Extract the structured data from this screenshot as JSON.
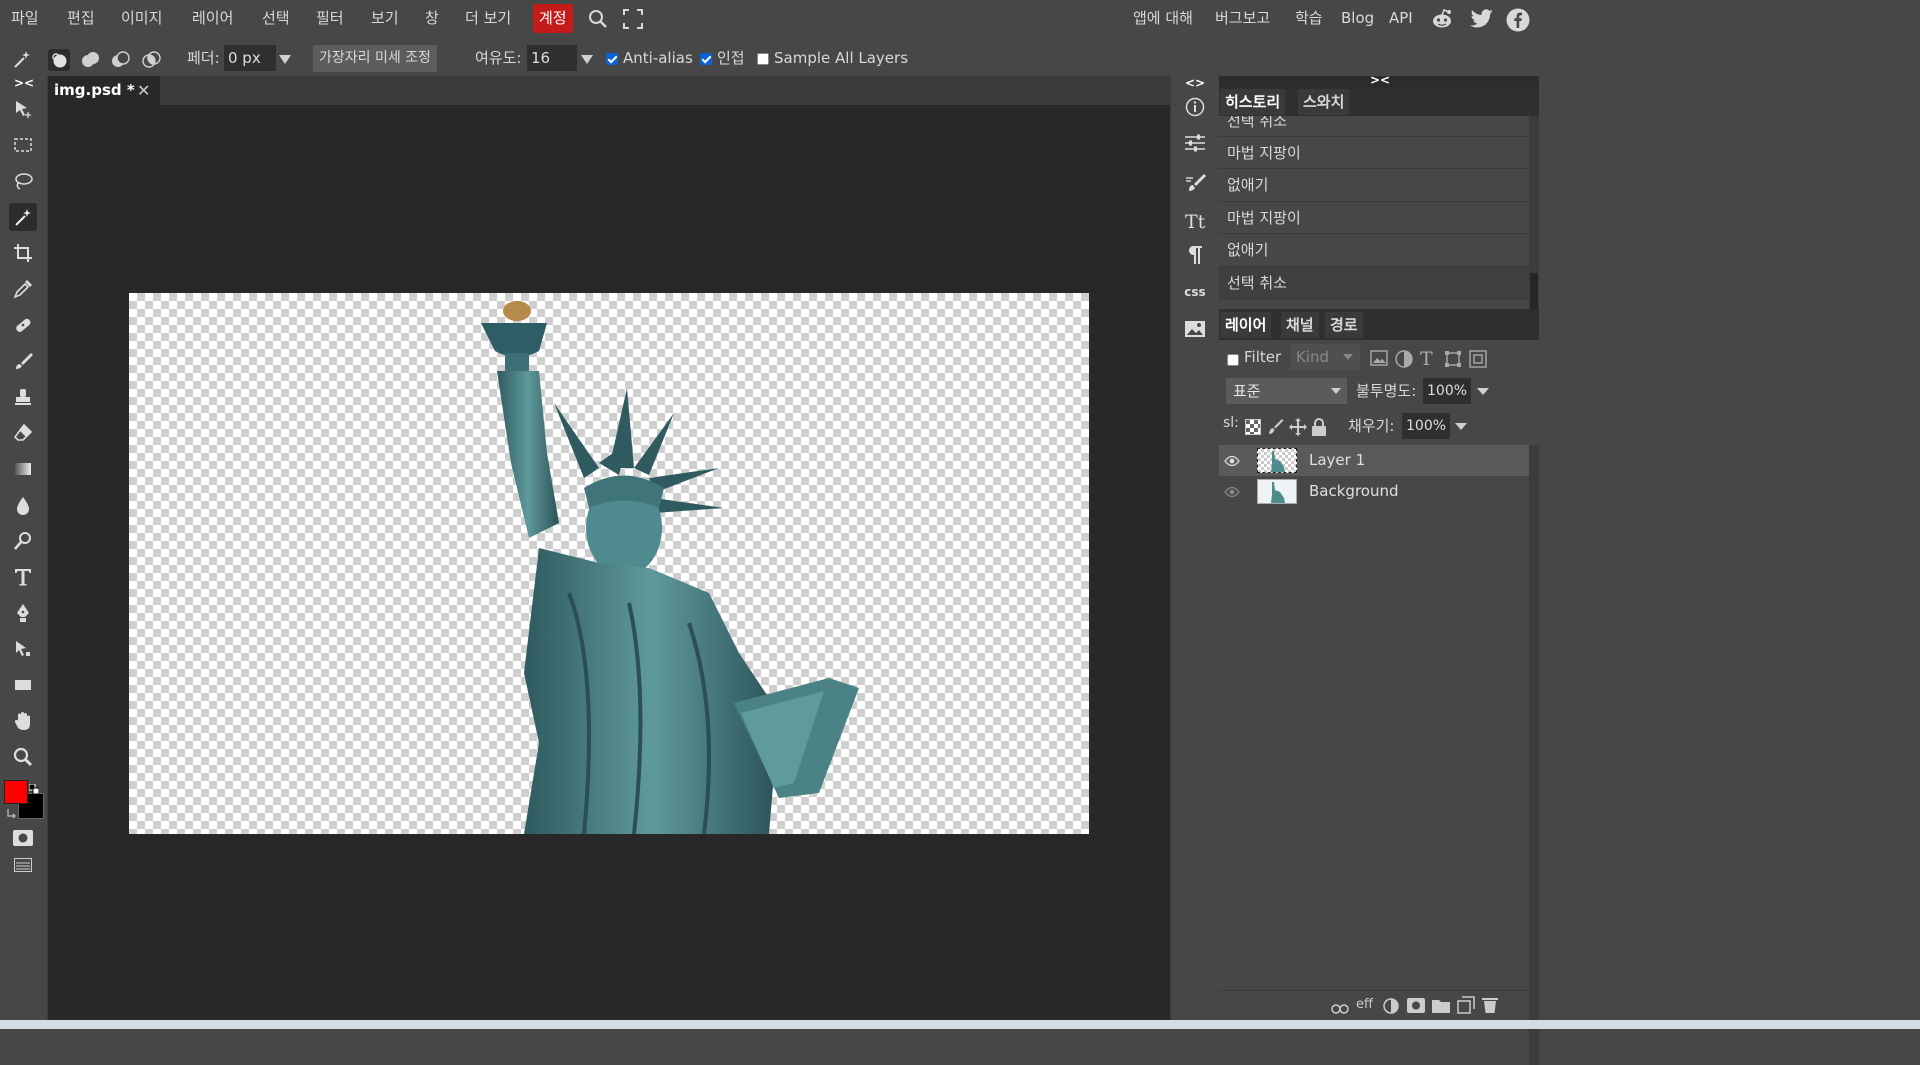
{
  "menubar": {
    "items": [
      "파일",
      "편집",
      "이미지",
      "레이어",
      "선택",
      "필터",
      "보기",
      "창",
      "더 보기"
    ],
    "account": "계정",
    "right_links": [
      "앱에 대해",
      "버그보고",
      "학습",
      "Blog",
      "API"
    ],
    "account_color": "#c41a1a"
  },
  "options": {
    "feather_label": "페더:",
    "feather_value": "0 px",
    "refine_edge": "가장자리 미세 조정",
    "tolerance_label": "여유도:",
    "tolerance_value": "16",
    "antialias_label": "Anti-alias",
    "antialias_checked": true,
    "contiguous_label": "인접",
    "contiguous_checked": true,
    "sample_all_label": "Sample All Layers",
    "sample_all_checked": false
  },
  "toolbar": {
    "collapse": "><",
    "active_tool": "magic-wand",
    "foreground_color": "#ff0000",
    "background_color": "#000000"
  },
  "document": {
    "tab_title": "img.psd *",
    "close": "✕"
  },
  "sidecol": {
    "collapse": "<>",
    "css_label": "css"
  },
  "history_panel": {
    "collapse": "><",
    "tabs": [
      "히스토리",
      "스와치"
    ],
    "items": [
      "선택 취소",
      "마법 지팡이",
      "없애기",
      "마법 지팡이",
      "없애기",
      "선택 취소"
    ]
  },
  "layers_panel": {
    "tabs": [
      "레이어",
      "채널",
      "경로"
    ],
    "filter_label": "Filter",
    "kind_label": "Kind",
    "blend_mode": "표준",
    "opacity_label": "불투명도:",
    "opacity_value": "100%",
    "lock_label": "sl:",
    "fill_label": "채우기:",
    "fill_value": "100%",
    "layers": [
      {
        "name": "Layer 1",
        "visible": true,
        "selected": true
      },
      {
        "name": "Background",
        "visible": true,
        "selected": false
      }
    ],
    "footer_eff": "eff"
  }
}
